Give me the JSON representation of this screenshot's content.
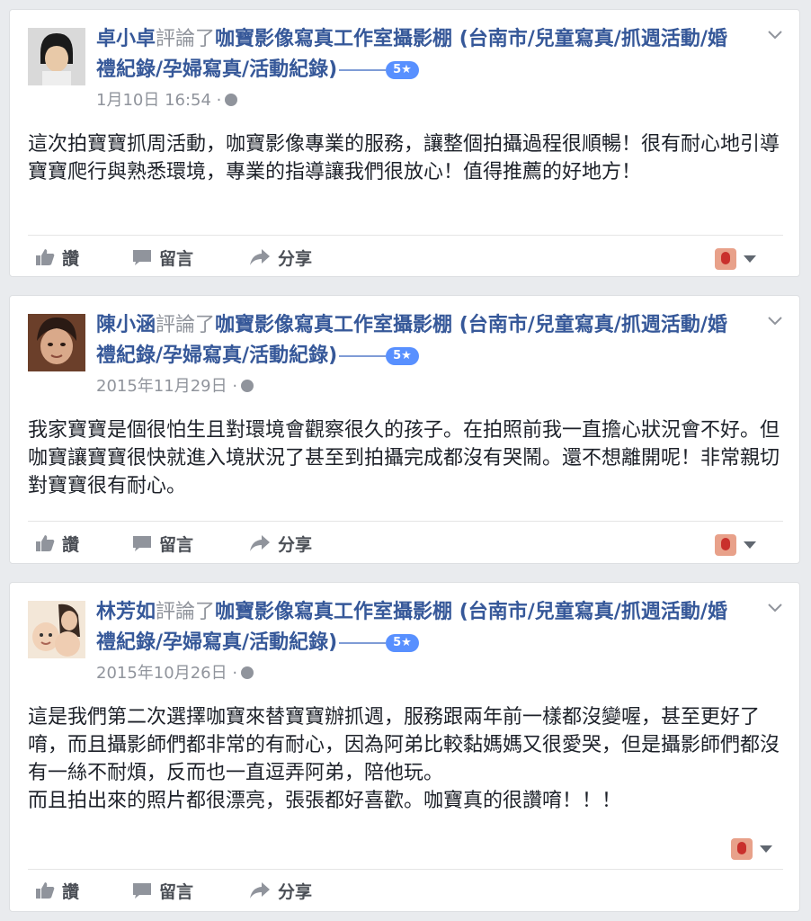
{
  "reviews": [
    {
      "author": "卓小卓",
      "verb": "評論了",
      "page": "咖寶影像寫真工作室攝影棚 (台南市/兒童寫真/抓週活動/婚禮紀錄/孕婦寫真/活動紀錄)",
      "rating": "5★",
      "time": "1月10日 16:54 ·",
      "text": "這次拍寶寶抓周活動，咖寶影像專業的服務，讓整個拍攝過程很順暢！很有耐心地引導寶寶爬行與熟悉環境，專業的指導讓我們很放心！值得推薦的好地方！"
    },
    {
      "author": "陳小涵",
      "verb": "評論了",
      "page": "咖寶影像寫真工作室攝影棚 (台南市/兒童寫真/抓週活動/婚禮紀錄/孕婦寫真/活動紀錄)",
      "rating": "5★",
      "time": "2015年11月29日 ·",
      "text": "我家寶寶是個很怕生且對環境會觀察很久的孩子。在拍照前我一直擔心狀況會不好。但咖寶讓寶寶很快就進入境狀況了甚至到拍攝完成都沒有哭鬧。還不想離開呢！非常親切對寶寶很有耐心。"
    },
    {
      "author": "林芳如",
      "verb": "評論了",
      "page": "咖寶影像寫真工作室攝影棚 (台南市/兒童寫真/抓週活動/婚禮紀錄/孕婦寫真/活動紀錄)",
      "rating": "5★",
      "time": "2015年10月26日 ·",
      "text": "這是我們第二次選擇咖寶來替寶寶辦抓週，服務跟兩年前一樣都沒變喔，甚至更好了唷，而且攝影師們都非常的有耐心，因為阿弟比較黏媽媽又很愛哭，但是攝影師們都沒有一絲不耐煩，反而也一直逗弄阿弟，陪他玩。\n而且拍出來的照片都很漂亮，張張都好喜歡。咖寶真的很讚唷！！！"
    }
  ],
  "actions": {
    "like": "讚",
    "comment": "留言",
    "share": "分享"
  },
  "icons": {
    "like": "thumbs-up-icon",
    "comment": "speech-bubble-icon",
    "share": "share-arrow-icon",
    "privacy": "globe-icon",
    "menu": "chevron-down-icon"
  }
}
